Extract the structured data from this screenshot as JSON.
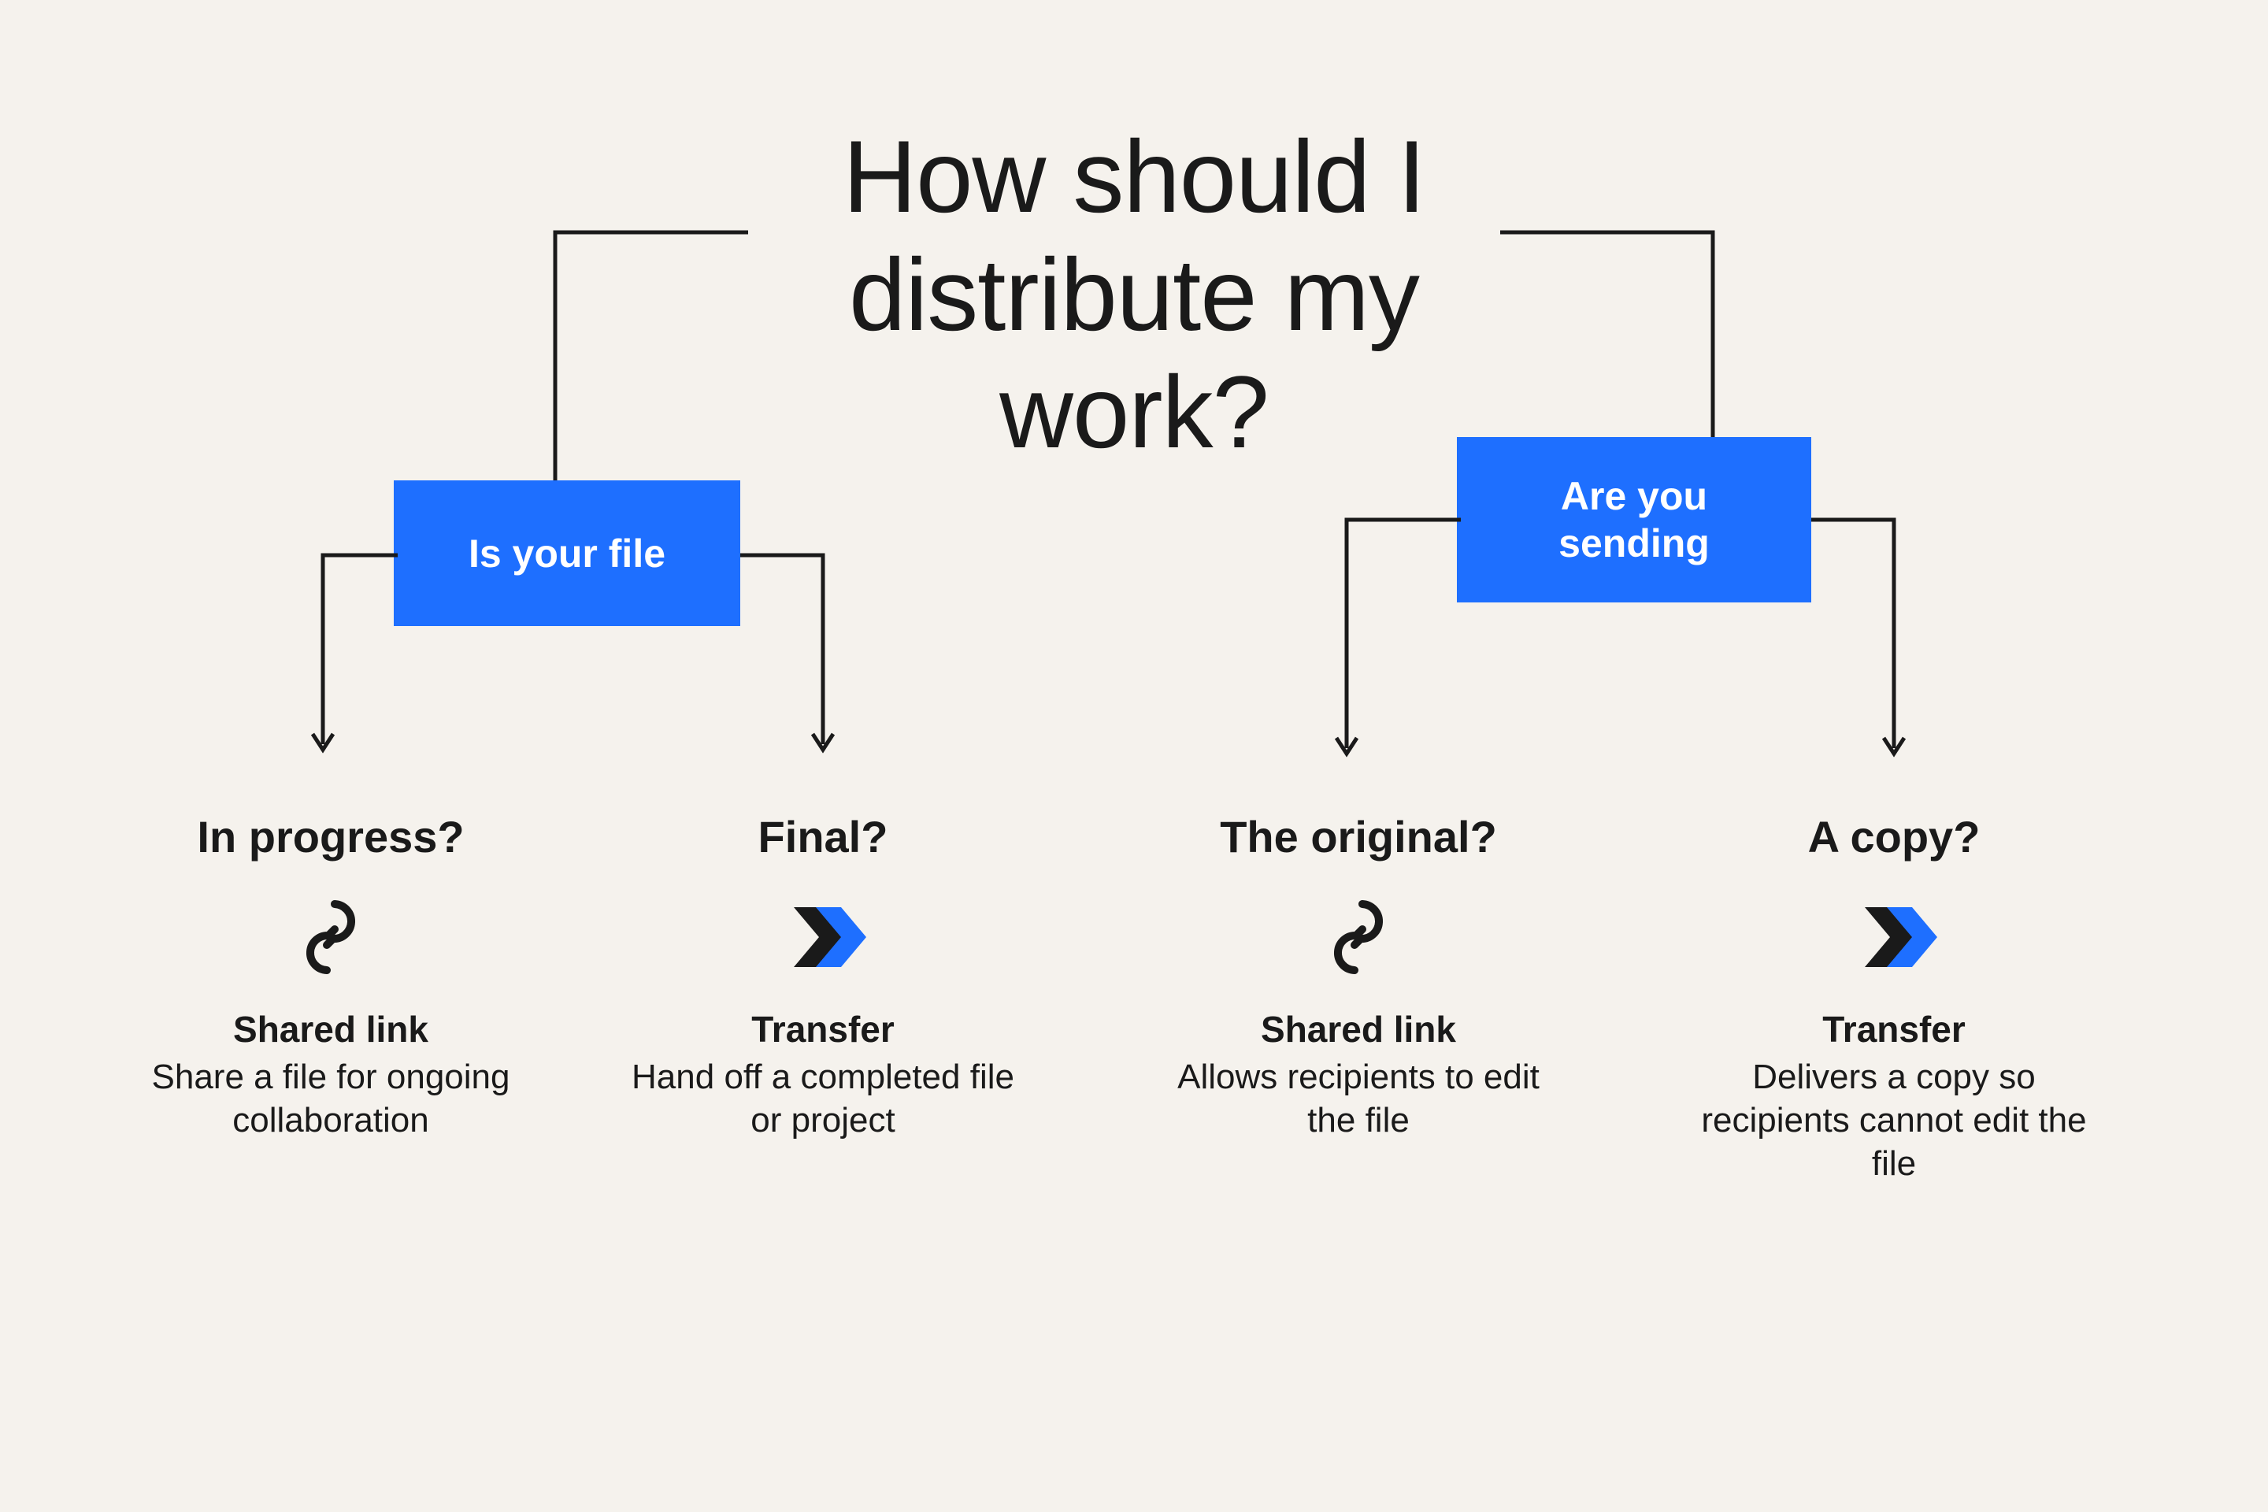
{
  "title": "How should I\ndistribute my\nwork?",
  "decisions": {
    "left": {
      "label": "Is your file"
    },
    "right": {
      "label": "Are you\nsending"
    }
  },
  "leaves": [
    {
      "question": "In progress?",
      "icon": "link",
      "label": "Shared link",
      "desc": "Share a file for ongoing collaboration"
    },
    {
      "question": "Final?",
      "icon": "transfer",
      "label": "Transfer",
      "desc": "Hand off a completed file or project"
    },
    {
      "question": "The original?",
      "icon": "link",
      "label": "Shared link",
      "desc": "Allows recipients to edit the file"
    },
    {
      "question": "A copy?",
      "icon": "transfer",
      "label": "Transfer",
      "desc": "Delivers a copy so recipients cannot edit the file"
    }
  ],
  "colors": {
    "bg": "#f5f2ed",
    "text": "#1a1a1a",
    "accent": "#1e6fff"
  }
}
